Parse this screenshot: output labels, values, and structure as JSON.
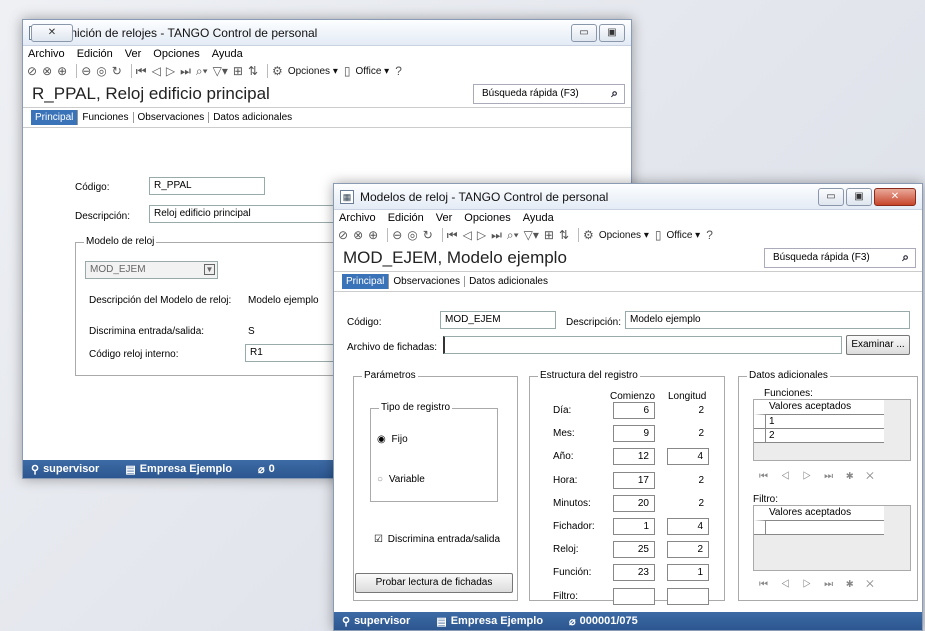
{
  "win1": {
    "title": "Definición de relojes - TANGO Control de personal",
    "app_icon": "calendar-icon",
    "controls": {
      "minimize": "▭",
      "maximize": "▣",
      "close": "✕"
    },
    "menu": [
      "Archivo",
      "Edición",
      "Ver",
      "Opciones",
      "Ayuda"
    ],
    "toolbar": {
      "options_label": "Opciones ▾",
      "office_label": "Office ▾"
    },
    "record_title": "R_PPAL, Reloj edificio principal",
    "search_placeholder": "Búsqueda rápida (F3)",
    "tabs": [
      "Principal",
      "Funciones",
      "Observaciones",
      "Datos adicionales"
    ],
    "codigo_label": "Código:",
    "codigo_value": "R_PPAL",
    "descripcion_label": "Descripción:",
    "descripcion_value": "Reloj edificio principal",
    "modelo_group_label": "Modelo de reloj",
    "modelo_select": "MOD_EJEM",
    "desc_modelo_label": "Descripción del Modelo de reloj:",
    "desc_modelo_value": "Modelo ejemplo",
    "discrimina_label": "Discrimina entrada/salida:",
    "discrimina_value": "S",
    "codigo_interno_label": "Código reloj interno:",
    "codigo_interno_value": "R1",
    "status": {
      "user": "supervisor",
      "company": "Empresa Ejemplo",
      "extra": "0"
    }
  },
  "win2": {
    "title": "Modelos de reloj - TANGO Control de personal",
    "app_icon": "calendar-icon",
    "controls": {
      "minimize": "▭",
      "maximize": "▣",
      "close": "✕"
    },
    "menu": [
      "Archivo",
      "Edición",
      "Ver",
      "Opciones",
      "Ayuda"
    ],
    "toolbar": {
      "options_label": "Opciones ▾",
      "office_label": "Office ▾"
    },
    "record_title": "MOD_EJEM, Modelo ejemplo",
    "search_placeholder": "Búsqueda rápida (F3)",
    "tabs": [
      "Principal",
      "Observaciones",
      "Datos adicionales"
    ],
    "codigo_label": "Código:",
    "codigo_value": "MOD_EJEM",
    "descripcion_label": "Descripción:",
    "descripcion_value": "Modelo ejemplo",
    "archivo_label": "Archivo de fichadas:",
    "archivo_value": "",
    "examinar_label": "Examinar ...",
    "parametros_label": "Parámetros",
    "tipo_registro_label": "Tipo de registro",
    "fijo_label": "Fijo",
    "variable_label": "Variable",
    "discrimina_label": "Discrimina entrada/salida",
    "probar_label": "Probar lectura de fichadas",
    "estructura_label": "Estructura del registro",
    "col_comienzo": "Comienzo",
    "col_longitud": "Longitud",
    "estructura_rows": [
      {
        "label": "Día:",
        "comienzo": "6",
        "longitud": "2"
      },
      {
        "label": "Mes:",
        "comienzo": "9",
        "longitud": "2"
      },
      {
        "label": "Año:",
        "comienzo": "12",
        "longitud": "4"
      },
      {
        "label": "Hora:",
        "comienzo": "17",
        "longitud": "2"
      },
      {
        "label": "Minutos:",
        "comienzo": "20",
        "longitud": "2"
      },
      {
        "label": "Fichador:",
        "comienzo": "1",
        "longitud": "4"
      },
      {
        "label": "Reloj:",
        "comienzo": "25",
        "longitud": "2"
      },
      {
        "label": "Función:",
        "comienzo": "23",
        "longitud": "1"
      },
      {
        "label": "Filtro:",
        "comienzo": "",
        "longitud": ""
      }
    ],
    "datos_adicionales_label": "Datos adicionales",
    "funciones_label": "Funciones:",
    "funciones_header": "Valores aceptados",
    "funciones_values": [
      "1",
      "2"
    ],
    "filtro_label": "Filtro:",
    "filtro_header": "Valores aceptados",
    "nav_glyphs": "⏮ ◁ ▷ ⏭ ✱ ✕",
    "status": {
      "user": "supervisor",
      "company": "Empresa Ejemplo",
      "extra": "000001/075"
    }
  }
}
